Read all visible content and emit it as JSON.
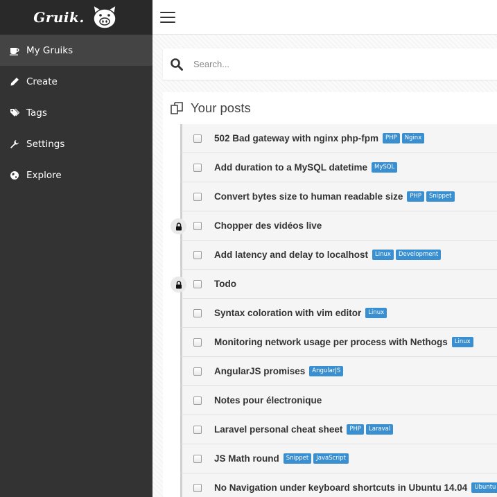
{
  "brand": {
    "name": "Gruik."
  },
  "sidebar": {
    "items": [
      {
        "label": "My Gruiks",
        "icon": "coffee-cup-icon",
        "active": true
      },
      {
        "label": "Create",
        "icon": "pencil-icon",
        "active": false
      },
      {
        "label": "Tags",
        "icon": "tags-icon",
        "active": false
      },
      {
        "label": "Settings",
        "icon": "wrench-icon",
        "active": false
      },
      {
        "label": "Explore",
        "icon": "globe-icon",
        "active": false
      }
    ]
  },
  "search": {
    "placeholder": "Search..."
  },
  "posts": {
    "title": "Your posts",
    "items": [
      {
        "title": "502 Bad gateway with nginx php-fpm",
        "tags": [
          "PHP",
          "Nginx"
        ],
        "locked": false
      },
      {
        "title": "Add duration to a MySQL datetime",
        "tags": [
          "MySQL"
        ],
        "locked": false
      },
      {
        "title": "Convert bytes size to human readable size",
        "tags": [
          "PHP",
          "Snippet"
        ],
        "locked": false
      },
      {
        "title": "Chopper des vidéos live",
        "tags": [],
        "locked": true
      },
      {
        "title": "Add latency and delay to localhost",
        "tags": [
          "Linux",
          "Development"
        ],
        "locked": false
      },
      {
        "title": "Todo",
        "tags": [],
        "locked": true
      },
      {
        "title": "Syntax coloration with vim editor",
        "tags": [
          "Linux"
        ],
        "locked": false
      },
      {
        "title": "Monitoring network usage per process with Nethogs",
        "tags": [
          "Linux"
        ],
        "locked": false
      },
      {
        "title": "AngularJS promises",
        "tags": [
          "AngularJS"
        ],
        "locked": false
      },
      {
        "title": "Notes pour électronique",
        "tags": [],
        "locked": false
      },
      {
        "title": "Laravel personal cheat sheet",
        "tags": [
          "PHP",
          "Laraval"
        ],
        "locked": false
      },
      {
        "title": "JS Math round",
        "tags": [
          "Snippet",
          "JavaScript"
        ],
        "locked": false
      },
      {
        "title": "No Navigation under keyboard shortcuts in Ubuntu 14.04",
        "tags": [
          "Ubuntu"
        ],
        "locked": false
      }
    ]
  },
  "colors": {
    "sidebar": "#333333",
    "tag": "#3a8fd1",
    "accent_text": "#333333"
  }
}
